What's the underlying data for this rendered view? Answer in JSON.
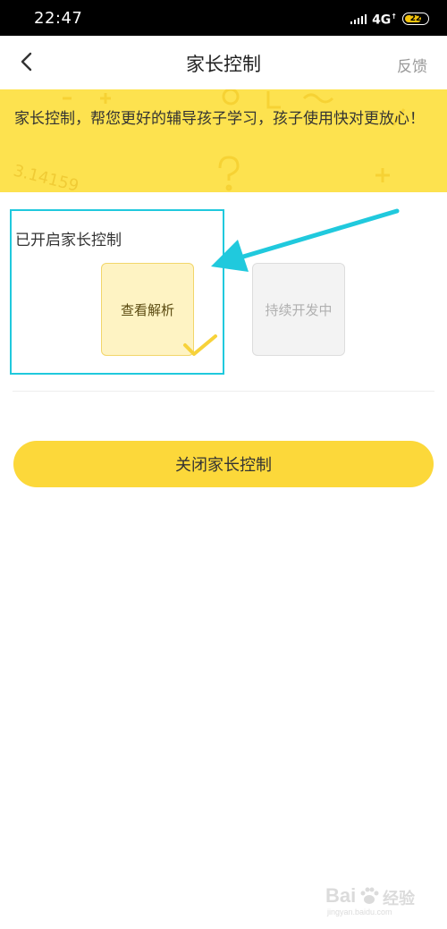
{
  "status_bar": {
    "time": "22:47",
    "network": "4G",
    "battery": "22"
  },
  "nav": {
    "title": "家长控制",
    "feedback_label": "反馈"
  },
  "banner": {
    "text": "家长控制，帮您更好的辅导孩子学习，孩子使用快对更放心！",
    "decor_text": "3.14159"
  },
  "section": {
    "enabled_label": "已开启家长控制",
    "cards": [
      {
        "label": "查看解析",
        "selected": true
      },
      {
        "label": "持续开发中",
        "selected": false
      }
    ]
  },
  "close_button_label": "关闭家长控制",
  "watermark": {
    "main": "Bai",
    "suffix": "经验",
    "sub": "jingyan.baidu.com"
  },
  "colors": {
    "banner": "#fde24f",
    "button": "#fcd83a",
    "highlight": "#20c9dd",
    "card_selected": "#fef3c3"
  }
}
